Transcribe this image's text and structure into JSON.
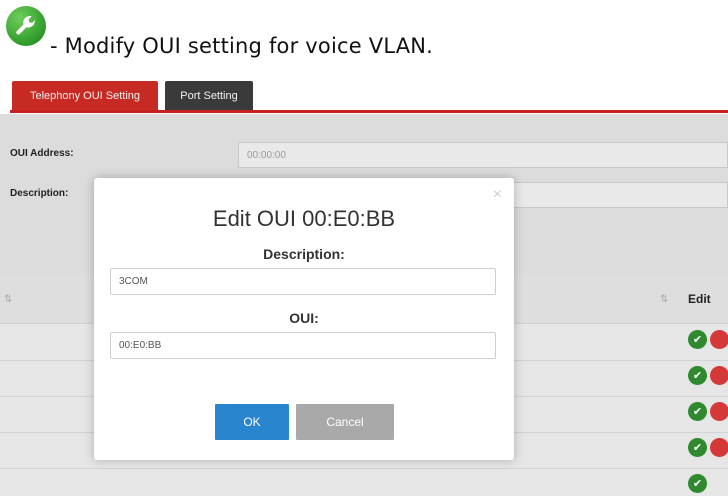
{
  "instruction": {
    "icon": "wrench-icon",
    "text": "- Modify OUI setting for voice VLAN."
  },
  "tabs": [
    {
      "label": "Telephony OUI Setting"
    },
    {
      "label": "Port Setting"
    }
  ],
  "form": {
    "oui_label": "OUI Address:",
    "oui_value": "00:00:00",
    "desc_label": "Description:"
  },
  "table": {
    "edit_header": "Edit"
  },
  "modal": {
    "close": "×",
    "title": "Edit OUI 00:E0:BB",
    "description_label": "Description:",
    "description_value": "3COM",
    "oui_label": "OUI:",
    "oui_value": "00:E0:BB",
    "ok": "OK",
    "cancel": "Cancel"
  },
  "colors": {
    "tab_active": "#c62a22",
    "tab_inactive": "#3a3a3a",
    "ok_button": "#2a85cf",
    "cancel_button": "#a9a9a9",
    "icon_green": "#2f9a2a"
  }
}
